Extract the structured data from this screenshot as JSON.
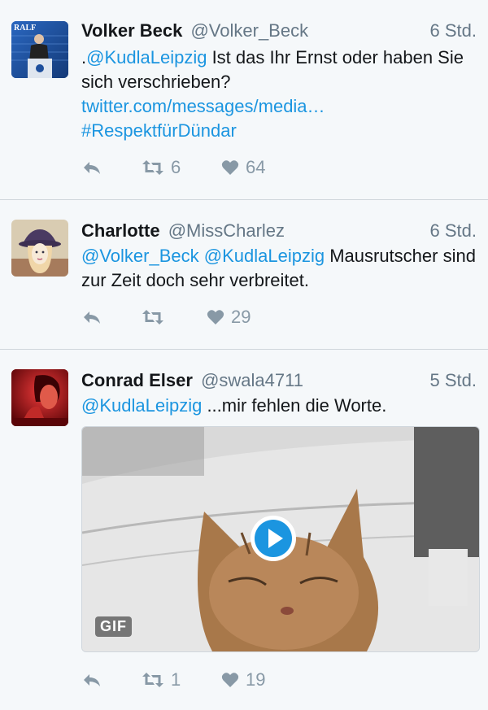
{
  "accent_color": "#1b95e0",
  "tweets": [
    {
      "name": "Volker Beck",
      "handle": "@Volker_Beck",
      "time": "6 Std.",
      "text_prefix": ".",
      "mention": "@KudlaLeipzig",
      "text_rest": " Ist das Ihr Ernst oder haben Sie sich verschrieben?",
      "link": "twitter.com/messages/media…",
      "hashtag": "#RespektfürDündar",
      "retweets": "6",
      "likes": "64",
      "avatar_caption": "RALF"
    },
    {
      "name": "Charlotte",
      "handle": "@MissCharlez",
      "time": "6 Std.",
      "mention1": "@Volker_Beck",
      "mention2": "@KudlaLeipzig",
      "text_rest": " Mausrutscher sind zur Zeit doch sehr verbreitet.",
      "retweets": "",
      "likes": "29"
    },
    {
      "name": "Conrad Elser",
      "handle": "@swala4711",
      "time": "5 Std.",
      "mention": "@KudlaLeipzig",
      "text_rest": " ...mir fehlen die Worte.",
      "media_badge": "GIF",
      "retweets": "1",
      "likes": "19"
    }
  ],
  "icons": [
    "reply-icon",
    "retweet-icon",
    "like-icon",
    "play-icon"
  ]
}
